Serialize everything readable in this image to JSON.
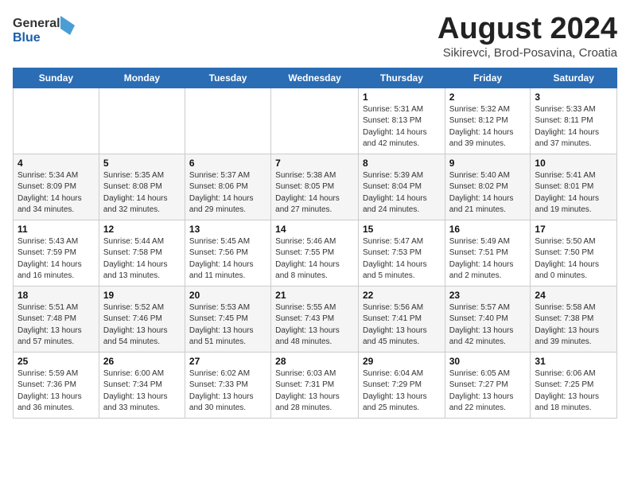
{
  "logo": {
    "line1": "General",
    "line2": "Blue"
  },
  "title": "August 2024",
  "subtitle": "Sikirevci, Brod-Posavina, Croatia",
  "days_header": [
    "Sunday",
    "Monday",
    "Tuesday",
    "Wednesday",
    "Thursday",
    "Friday",
    "Saturday"
  ],
  "weeks": [
    [
      {
        "num": "",
        "info": ""
      },
      {
        "num": "",
        "info": ""
      },
      {
        "num": "",
        "info": ""
      },
      {
        "num": "",
        "info": ""
      },
      {
        "num": "1",
        "info": "Sunrise: 5:31 AM\nSunset: 8:13 PM\nDaylight: 14 hours\nand 42 minutes."
      },
      {
        "num": "2",
        "info": "Sunrise: 5:32 AM\nSunset: 8:12 PM\nDaylight: 14 hours\nand 39 minutes."
      },
      {
        "num": "3",
        "info": "Sunrise: 5:33 AM\nSunset: 8:11 PM\nDaylight: 14 hours\nand 37 minutes."
      }
    ],
    [
      {
        "num": "4",
        "info": "Sunrise: 5:34 AM\nSunset: 8:09 PM\nDaylight: 14 hours\nand 34 minutes."
      },
      {
        "num": "5",
        "info": "Sunrise: 5:35 AM\nSunset: 8:08 PM\nDaylight: 14 hours\nand 32 minutes."
      },
      {
        "num": "6",
        "info": "Sunrise: 5:37 AM\nSunset: 8:06 PM\nDaylight: 14 hours\nand 29 minutes."
      },
      {
        "num": "7",
        "info": "Sunrise: 5:38 AM\nSunset: 8:05 PM\nDaylight: 14 hours\nand 27 minutes."
      },
      {
        "num": "8",
        "info": "Sunrise: 5:39 AM\nSunset: 8:04 PM\nDaylight: 14 hours\nand 24 minutes."
      },
      {
        "num": "9",
        "info": "Sunrise: 5:40 AM\nSunset: 8:02 PM\nDaylight: 14 hours\nand 21 minutes."
      },
      {
        "num": "10",
        "info": "Sunrise: 5:41 AM\nSunset: 8:01 PM\nDaylight: 14 hours\nand 19 minutes."
      }
    ],
    [
      {
        "num": "11",
        "info": "Sunrise: 5:43 AM\nSunset: 7:59 PM\nDaylight: 14 hours\nand 16 minutes."
      },
      {
        "num": "12",
        "info": "Sunrise: 5:44 AM\nSunset: 7:58 PM\nDaylight: 14 hours\nand 13 minutes."
      },
      {
        "num": "13",
        "info": "Sunrise: 5:45 AM\nSunset: 7:56 PM\nDaylight: 14 hours\nand 11 minutes."
      },
      {
        "num": "14",
        "info": "Sunrise: 5:46 AM\nSunset: 7:55 PM\nDaylight: 14 hours\nand 8 minutes."
      },
      {
        "num": "15",
        "info": "Sunrise: 5:47 AM\nSunset: 7:53 PM\nDaylight: 14 hours\nand 5 minutes."
      },
      {
        "num": "16",
        "info": "Sunrise: 5:49 AM\nSunset: 7:51 PM\nDaylight: 14 hours\nand 2 minutes."
      },
      {
        "num": "17",
        "info": "Sunrise: 5:50 AM\nSunset: 7:50 PM\nDaylight: 14 hours\nand 0 minutes."
      }
    ],
    [
      {
        "num": "18",
        "info": "Sunrise: 5:51 AM\nSunset: 7:48 PM\nDaylight: 13 hours\nand 57 minutes."
      },
      {
        "num": "19",
        "info": "Sunrise: 5:52 AM\nSunset: 7:46 PM\nDaylight: 13 hours\nand 54 minutes."
      },
      {
        "num": "20",
        "info": "Sunrise: 5:53 AM\nSunset: 7:45 PM\nDaylight: 13 hours\nand 51 minutes."
      },
      {
        "num": "21",
        "info": "Sunrise: 5:55 AM\nSunset: 7:43 PM\nDaylight: 13 hours\nand 48 minutes."
      },
      {
        "num": "22",
        "info": "Sunrise: 5:56 AM\nSunset: 7:41 PM\nDaylight: 13 hours\nand 45 minutes."
      },
      {
        "num": "23",
        "info": "Sunrise: 5:57 AM\nSunset: 7:40 PM\nDaylight: 13 hours\nand 42 minutes."
      },
      {
        "num": "24",
        "info": "Sunrise: 5:58 AM\nSunset: 7:38 PM\nDaylight: 13 hours\nand 39 minutes."
      }
    ],
    [
      {
        "num": "25",
        "info": "Sunrise: 5:59 AM\nSunset: 7:36 PM\nDaylight: 13 hours\nand 36 minutes."
      },
      {
        "num": "26",
        "info": "Sunrise: 6:00 AM\nSunset: 7:34 PM\nDaylight: 13 hours\nand 33 minutes."
      },
      {
        "num": "27",
        "info": "Sunrise: 6:02 AM\nSunset: 7:33 PM\nDaylight: 13 hours\nand 30 minutes."
      },
      {
        "num": "28",
        "info": "Sunrise: 6:03 AM\nSunset: 7:31 PM\nDaylight: 13 hours\nand 28 minutes."
      },
      {
        "num": "29",
        "info": "Sunrise: 6:04 AM\nSunset: 7:29 PM\nDaylight: 13 hours\nand 25 minutes."
      },
      {
        "num": "30",
        "info": "Sunrise: 6:05 AM\nSunset: 7:27 PM\nDaylight: 13 hours\nand 22 minutes."
      },
      {
        "num": "31",
        "info": "Sunrise: 6:06 AM\nSunset: 7:25 PM\nDaylight: 13 hours\nand 18 minutes."
      }
    ]
  ]
}
